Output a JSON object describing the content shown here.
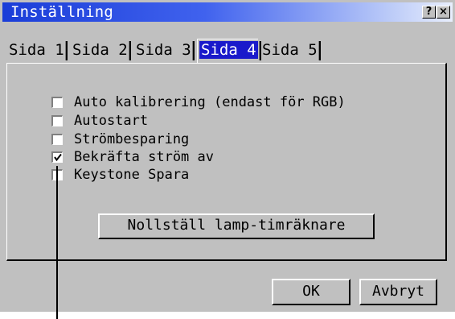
{
  "window": {
    "title": "Inställning",
    "help_button": "?",
    "close_button": "×"
  },
  "tabs": [
    {
      "label": "Sida 1",
      "active": false
    },
    {
      "label": "Sida 2",
      "active": false
    },
    {
      "label": "Sida 3",
      "active": false
    },
    {
      "label": "Sida 4",
      "active": true
    },
    {
      "label": "Sida 5",
      "active": false
    }
  ],
  "options": [
    {
      "label": "Auto kalibrering (endast för RGB)",
      "checked": false
    },
    {
      "label": "Autostart",
      "checked": false
    },
    {
      "label": "Strömbesparing",
      "checked": false
    },
    {
      "label": "Bekräfta ström av",
      "checked": true
    },
    {
      "label": "Keystone Spara",
      "checked": false
    }
  ],
  "reset_button": "Nollställ lamp-timräknare",
  "buttons": {
    "ok": "OK",
    "cancel": "Avbryt"
  }
}
